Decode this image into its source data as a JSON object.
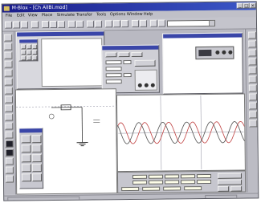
{
  "window": {
    "title": "M-Blox - [Ch AllBi.mod]"
  },
  "menu": [
    "File",
    "Edit",
    "View",
    "Place",
    "Simulate",
    "Transfer",
    "Tools",
    "Options",
    "Window",
    "Help"
  ],
  "colors": {
    "titlebar": "#1a1c8a",
    "trace_a": "#c04040",
    "trace_b": "#505050",
    "grid": "#8a8a9a"
  },
  "icons": {
    "minimize": "minimize-icon",
    "maximize": "maximize-icon",
    "close": "close-icon"
  },
  "oscilloscope": {
    "waveforms": [
      {
        "shape": "sine",
        "color": "#c04040",
        "cycles": 5.3,
        "phase_deg": 40
      },
      {
        "shape": "sine",
        "color": "#505050",
        "cycles": 5.3,
        "phase_deg": 130
      }
    ]
  }
}
